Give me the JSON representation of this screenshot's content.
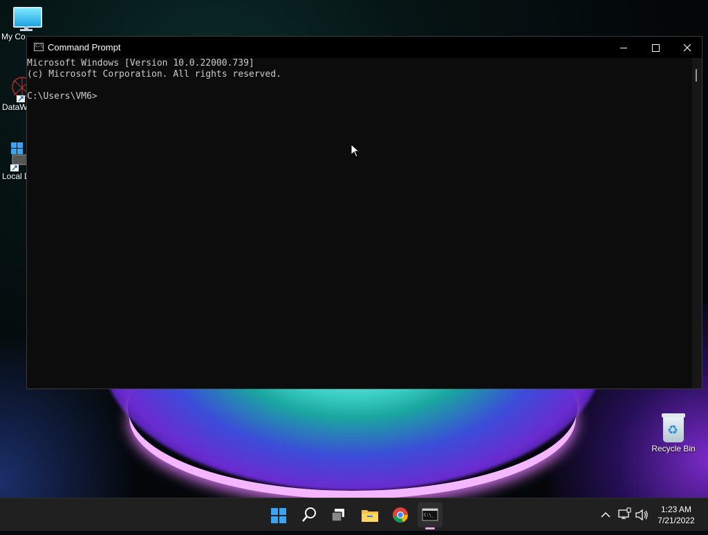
{
  "desktop": {
    "icons": [
      {
        "label": "My Co"
      },
      {
        "label": "DataW"
      },
      {
        "label": "Local D"
      },
      {
        "label": "Recycle Bin"
      }
    ]
  },
  "window": {
    "title": "Command Prompt",
    "controls": {
      "minimize": "minimize",
      "maximize": "maximize",
      "close": "close"
    },
    "console_lines": [
      "Microsoft Windows [Version 10.0.22000.739]",
      "(c) Microsoft Corporation. All rights reserved.",
      "",
      "C:\\Users\\VM6>"
    ]
  },
  "taskbar": {
    "apps": [
      {
        "name": "start-icon"
      },
      {
        "name": "search-icon"
      },
      {
        "name": "task-view-icon"
      },
      {
        "name": "file-explorer-icon"
      },
      {
        "name": "chrome-icon"
      },
      {
        "name": "command-prompt-icon",
        "active": true
      }
    ],
    "tray": {
      "time": "1:23 AM",
      "date": "7/21/2022"
    }
  },
  "colors": {
    "console_bg": "#0c0c0c",
    "console_text": "#cccccc",
    "taskbar_bg": "#202020",
    "accent": "#3aa4f5"
  }
}
